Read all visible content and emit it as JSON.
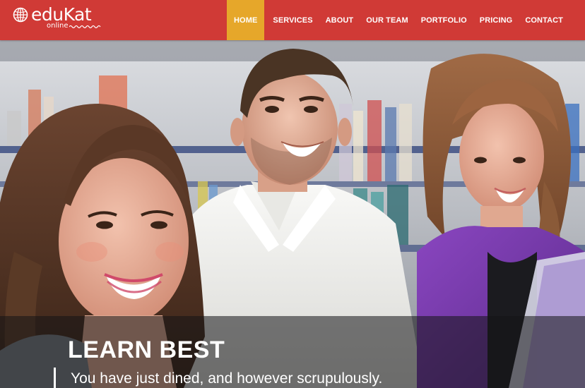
{
  "brand": {
    "name": "eduKat",
    "tagline": "online",
    "primary_color": "#d03a36",
    "accent_color": "#e6a72a",
    "logo_icon": "globe-icon"
  },
  "nav": {
    "items": [
      {
        "label": "HOME",
        "active": true
      },
      {
        "label": "SERVICES",
        "active": false
      },
      {
        "label": "ABOUT",
        "active": false
      },
      {
        "label": "OUR TEAM",
        "active": false
      },
      {
        "label": "PORTFOLIO",
        "active": false
      },
      {
        "label": "PRICING",
        "active": false
      },
      {
        "label": "CONTACT",
        "active": false
      }
    ]
  },
  "hero": {
    "title": "LEARN BEST",
    "subtitle": "You have just dined, and however scrupulously."
  }
}
